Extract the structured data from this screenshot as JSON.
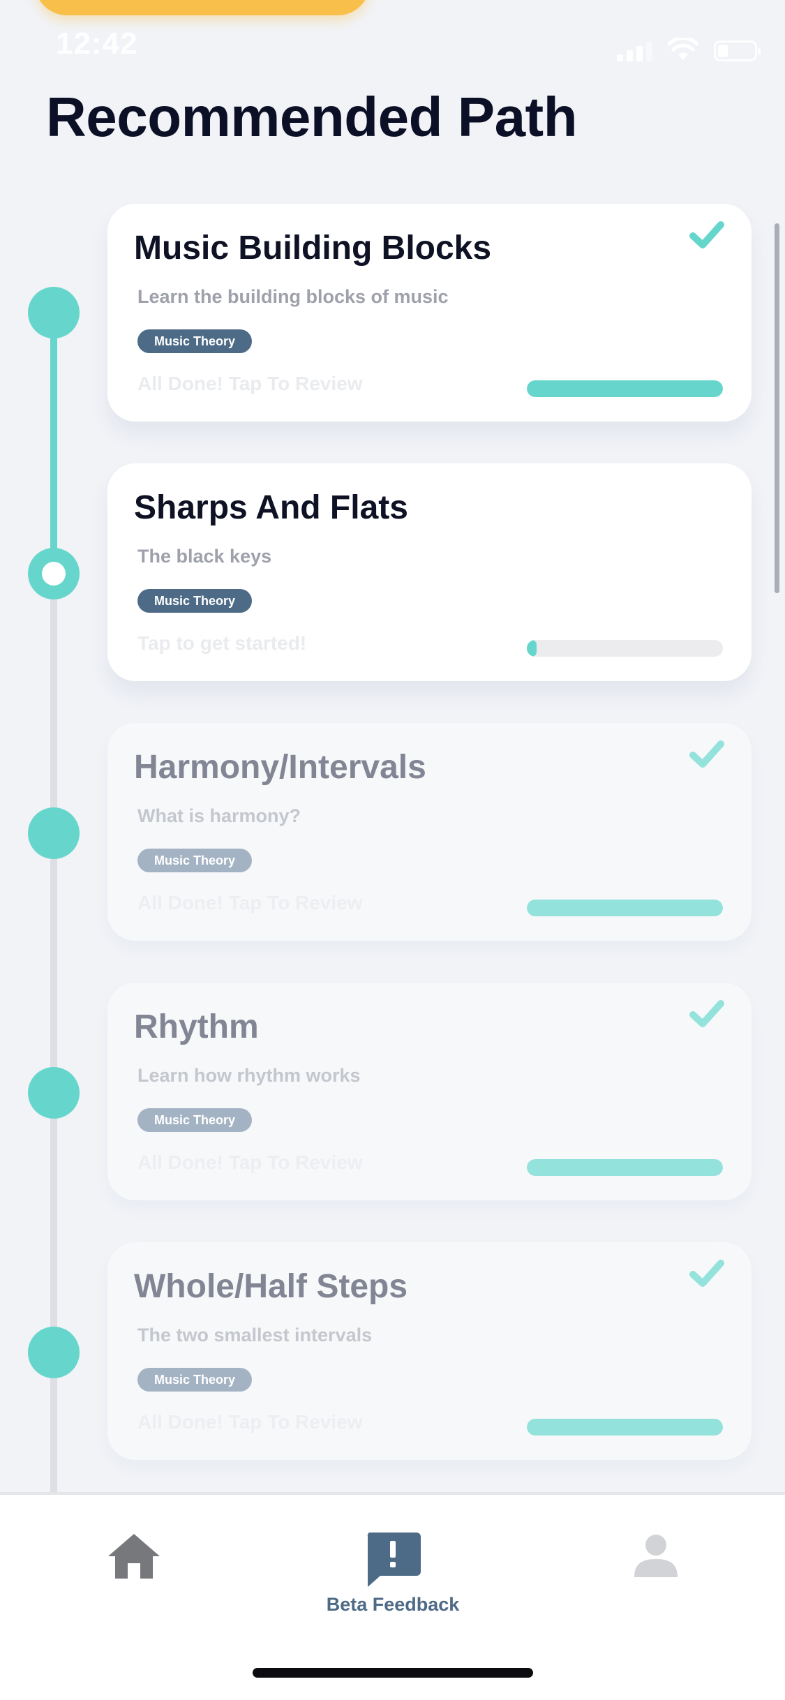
{
  "status_bar": {
    "time": "12:42"
  },
  "page": {
    "title": "Recommended Path"
  },
  "colors": {
    "accent_teal": "#66d6cc",
    "tag_blue": "#4d6a86",
    "top_pill_orange": "#f8c04a",
    "title_dark": "#0c1026"
  },
  "lessons": [
    {
      "title": "Music Building Blocks",
      "description": "Learn the building blocks of music",
      "tag": "Music Theory",
      "status": "All Done! Tap To Review",
      "progress": 1.0,
      "completed": true,
      "icon": "checkmark-icon"
    },
    {
      "title": "Sharps And Flats",
      "description": "The black keys",
      "tag": "Music Theory",
      "status": "Tap to get started!",
      "progress": 0.05,
      "completed": false,
      "current": true
    },
    {
      "title": "Harmony/Intervals",
      "description": "What is harmony?",
      "tag": "Music Theory",
      "status": "All Done! Tap To Review",
      "progress": 1.0,
      "completed": true,
      "icon": "checkmark-icon"
    },
    {
      "title": "Rhythm",
      "description": "Learn how rhythm works",
      "tag": "Music Theory",
      "status": "All Done! Tap To Review",
      "progress": 1.0,
      "completed": true,
      "icon": "checkmark-icon"
    },
    {
      "title": "Whole/Half Steps",
      "description": "The two smallest intervals",
      "tag": "Music Theory",
      "status": "All Done! Tap To Review",
      "progress": 1.0,
      "completed": true,
      "icon": "checkmark-icon"
    }
  ],
  "bottom_nav": {
    "items": [
      {
        "label": "",
        "icon": "home-icon"
      },
      {
        "label": "Beta Feedback",
        "icon": "feedback-icon",
        "active": true
      },
      {
        "label": "",
        "icon": "profile-icon"
      }
    ]
  }
}
